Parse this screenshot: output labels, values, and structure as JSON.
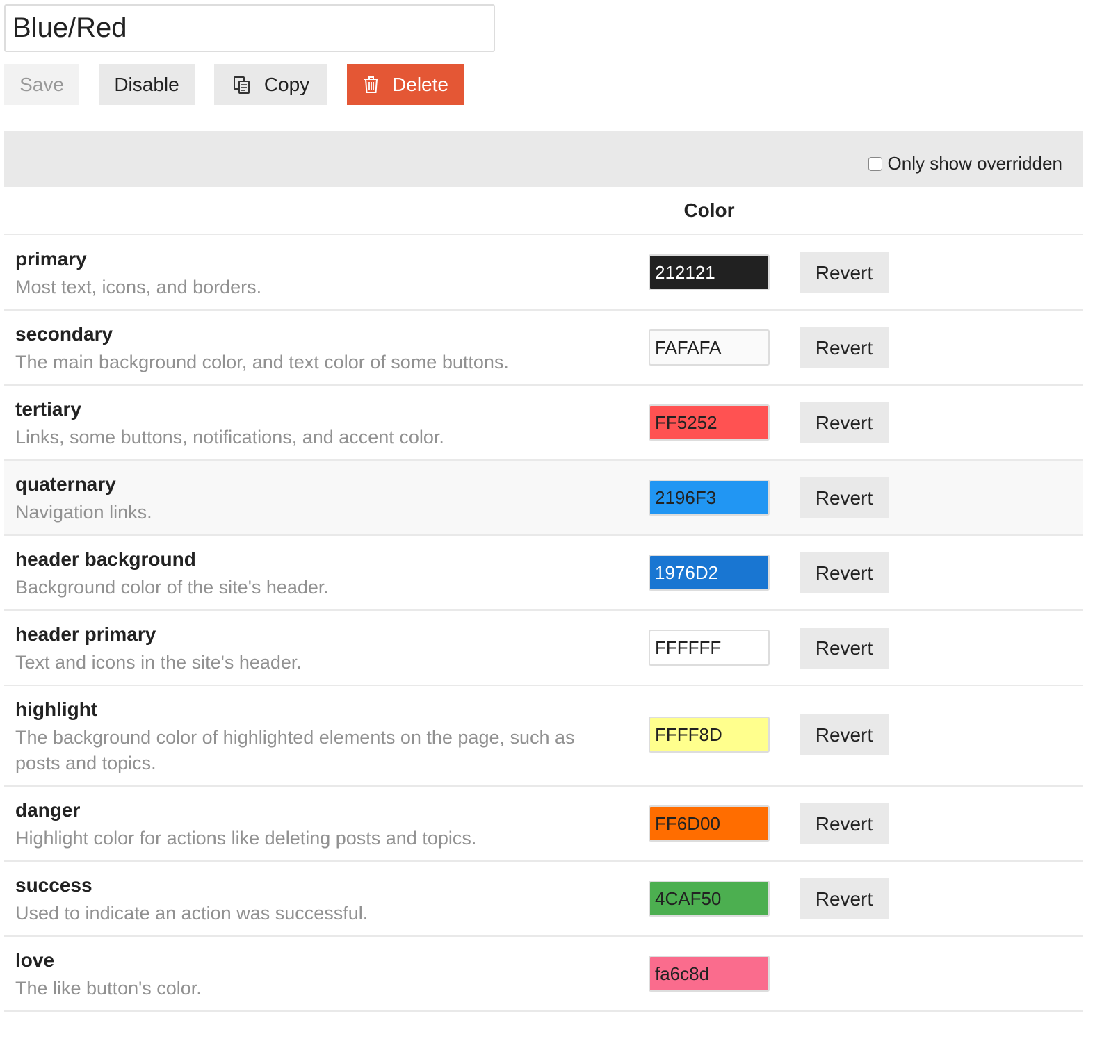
{
  "scheme": {
    "name": "Blue/Red"
  },
  "toolbar": {
    "save_label": "Save",
    "disable_label": "Disable",
    "copy_label": "Copy",
    "delete_label": "Delete",
    "copy_icon": "copy-icon",
    "delete_icon": "trash-icon"
  },
  "filter": {
    "only_overridden_label": "Only show overridden",
    "only_overridden_checked": false
  },
  "table": {
    "color_header": "Color",
    "revert_label": "Revert"
  },
  "colors": [
    {
      "name": "primary",
      "description": "Most text, icons, and borders.",
      "value": "212121",
      "bg": "#212121",
      "fg": "#ffffff",
      "revert": true
    },
    {
      "name": "secondary",
      "description": "The main background color, and text color of some buttons.",
      "value": "FAFAFA",
      "bg": "#fafafa",
      "fg": "#222222",
      "revert": true
    },
    {
      "name": "tertiary",
      "description": "Links, some buttons, notifications, and accent color.",
      "value": "FF5252",
      "bg": "#ff5252",
      "fg": "#222222",
      "revert": true
    },
    {
      "name": "quaternary",
      "description": "Navigation links.",
      "value": "2196F3",
      "bg": "#2196f3",
      "fg": "#222222",
      "revert": true
    },
    {
      "name": "header background",
      "description": "Background color of the site's header.",
      "value": "1976D2",
      "bg": "#1976d2",
      "fg": "#ffffff",
      "revert": true
    },
    {
      "name": "header primary",
      "description": "Text and icons in the site's header.",
      "value": "FFFFFF",
      "bg": "#ffffff",
      "fg": "#222222",
      "revert": true
    },
    {
      "name": "highlight",
      "description": "The background color of highlighted elements on the page, such as posts and topics.",
      "value": "FFFF8D",
      "bg": "#ffff8d",
      "fg": "#222222",
      "revert": true
    },
    {
      "name": "danger",
      "description": "Highlight color for actions like deleting posts and topics.",
      "value": "FF6D00",
      "bg": "#ff6d00",
      "fg": "#222222",
      "revert": true
    },
    {
      "name": "success",
      "description": "Used to indicate an action was successful.",
      "value": "4CAF50",
      "bg": "#4caf50",
      "fg": "#222222",
      "revert": true
    },
    {
      "name": "love",
      "description": "The like button's color.",
      "value": "fa6c8d",
      "bg": "#fa6c8d",
      "fg": "#222222",
      "revert": false
    }
  ]
}
